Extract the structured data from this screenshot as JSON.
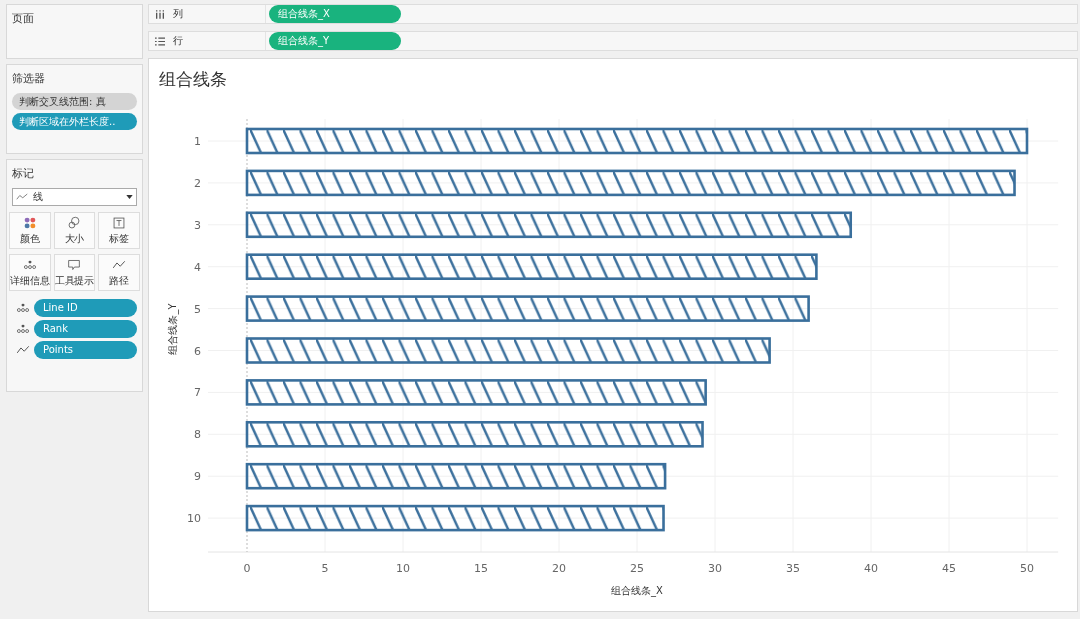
{
  "pages_shelf": {
    "title": "页面"
  },
  "columns_shelf": {
    "label": "列",
    "pills": [
      "组合线条_X"
    ]
  },
  "rows_shelf": {
    "label": "行",
    "pills": [
      "组合线条_Y"
    ]
  },
  "filters": {
    "title": "筛选器",
    "items": [
      {
        "label": "判断交叉线范围: 真",
        "color": "#d4d4d4"
      },
      {
        "label": "判断区域在外栏长度..",
        "color": "#1f9bb8"
      }
    ]
  },
  "marks": {
    "title": "标记",
    "mark_type": "线",
    "cards": [
      {
        "kind": "color",
        "label": "颜色"
      },
      {
        "kind": "size",
        "label": "大小"
      },
      {
        "kind": "label",
        "label": "标签"
      },
      {
        "kind": "detail",
        "label": "详细信息"
      },
      {
        "kind": "tooltip",
        "label": "工具提示"
      },
      {
        "kind": "path",
        "label": "路径"
      }
    ],
    "fields": [
      {
        "kind": "detail",
        "label": "Line ID"
      },
      {
        "kind": "detail",
        "label": "Rank"
      },
      {
        "kind": "path",
        "label": "Points"
      }
    ]
  },
  "view": {
    "title": "组合线条",
    "chart_data": {
      "type": "bar",
      "orientation": "horizontal",
      "xlabel": "组合线条_X",
      "ylabel": "组合线条_Y",
      "categories": [
        "1",
        "2",
        "3",
        "4",
        "5",
        "6",
        "7",
        "8",
        "9",
        "10"
      ],
      "values": [
        50,
        49.2,
        38.7,
        36.5,
        36,
        33.5,
        29.4,
        29.2,
        26.8,
        26.7
      ],
      "grid": true,
      "ref_lines": [
        {
          "axis": "x",
          "value": 0
        }
      ],
      "xlim": [
        -2.5,
        52
      ],
      "xticks": [
        0,
        5,
        10,
        15,
        20,
        25,
        30,
        35,
        40,
        45,
        50
      ]
    }
  }
}
